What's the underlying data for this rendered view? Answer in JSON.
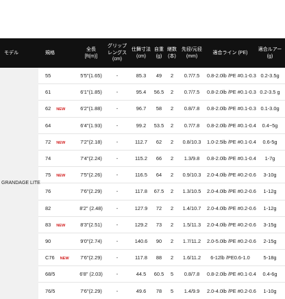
{
  "headers": {
    "model": "モデル",
    "spec": "規格",
    "length": "全長 [ft(m)]",
    "grip": "グリップ レングス (cm)",
    "closed": "仕舞寸法 (cm)",
    "weight": "自重 (g)",
    "pieces": "継数 (本)",
    "tip": "先径/元径 (mm)",
    "line": "適合ライン (PE)",
    "lure": "適合ルアー (g)"
  },
  "model_name": "GRANDAGE LITE",
  "new_label": "NEW",
  "rows": [
    {
      "spec": "55",
      "new": false,
      "length": "5'5\"(1.65)",
      "grip": "-",
      "closed": "85.3",
      "weight": "49",
      "pieces": "2",
      "tip": "0.7/7.5",
      "line": "0.8-2.0lb /PE #0.1-0.3",
      "lure": "0.2-3.5g"
    },
    {
      "spec": "61",
      "new": false,
      "length": "6'1\"(1.85)",
      "grip": "-",
      "closed": "95.4",
      "weight": "56.5",
      "pieces": "2",
      "tip": "0.7/7.5",
      "line": "0.8-2.0lb /PE #0.1-0.3",
      "lure": "0.2-3.5 g"
    },
    {
      "spec": "62",
      "new": true,
      "length": "6'2\"(1.88)",
      "grip": "-",
      "closed": "96.7",
      "weight": "58",
      "pieces": "2",
      "tip": "0.8/7.8",
      "line": "0.8-2.0lb /PE #0.1-0.3",
      "lure": "0.1-3.0g"
    },
    {
      "spec": "64",
      "new": false,
      "length": "6'4\"(1.93)",
      "grip": "-",
      "closed": "99.2",
      "weight": "53.5",
      "pieces": "2",
      "tip": "0.7/7.8",
      "line": "0.8-2.0lb /PE #0.1-0.4",
      "lure": "0.4~5g"
    },
    {
      "spec": "72",
      "new": true,
      "length": "7'2\"(2.18)",
      "grip": "-",
      "closed": "112.7",
      "weight": "62",
      "pieces": "2",
      "tip": "0.8/10.3",
      "line": "1.0-2.5lb /PE #0.1-0.4",
      "lure": "0.6-5g"
    },
    {
      "spec": "74",
      "new": false,
      "length": "7'4\"(2.24)",
      "grip": "-",
      "closed": "115.2",
      "weight": "66",
      "pieces": "2",
      "tip": "1.3/9.8",
      "line": "0.8-2.0lb /PE #0.1-0.4",
      "lure": "1-7g"
    },
    {
      "spec": "75",
      "new": true,
      "length": "7'5\"(2.26)",
      "grip": "-",
      "closed": "116.5",
      "weight": "64",
      "pieces": "2",
      "tip": "0.9/10.3",
      "line": "2.0-4.0lb /PE #0.2-0.6",
      "lure": "3-10g"
    },
    {
      "spec": "76",
      "new": false,
      "length": "7'6\"(2.29)",
      "grip": "-",
      "closed": "117.8",
      "weight": "67.5",
      "pieces": "2",
      "tip": "1.3/10.5",
      "line": "2.0-4.0lb /PE #0.2-0.6",
      "lure": "1-12g"
    },
    {
      "spec": "82",
      "new": false,
      "length": "8'2\" (2.48)",
      "grip": "-",
      "closed": "127.9",
      "weight": "72",
      "pieces": "2",
      "tip": "1.4/10.7",
      "line": "2.0-4.0lb /PE #0.2-0.6",
      "lure": "1-12g"
    },
    {
      "spec": "83",
      "new": true,
      "length": "8'3\"(2.51)",
      "grip": "-",
      "closed": "129.2",
      "weight": "73",
      "pieces": "2",
      "tip": "1.5/11.3",
      "line": "2.0-4.0lb /PE #0.2-0.6",
      "lure": "3-15g"
    },
    {
      "spec": "90",
      "new": false,
      "length": "9'0\"(2.74)",
      "grip": "-",
      "closed": "140.6",
      "weight": "90",
      "pieces": "2",
      "tip": "1.7/11.2",
      "line": "2.0-5.0lb /PE #0.2-0.6",
      "lure": "2-15g"
    },
    {
      "spec": "C76",
      "new": true,
      "length": "7'6\"(2.29)",
      "grip": "-",
      "closed": "117.8",
      "weight": "88",
      "pieces": "2",
      "tip": "1.6/11.2",
      "line": "6-12lb /PE0.6-1.0",
      "lure": "5-18g"
    },
    {
      "spec": "68/5",
      "new": false,
      "length": "6'8\" (2.03)",
      "grip": "-",
      "closed": "44.5",
      "weight": "60.5",
      "pieces": "5",
      "tip": "0.8/7.8",
      "line": "0.8-2.0lb /PE #0.1-0.4",
      "lure": "0.4-6g"
    },
    {
      "spec": "76/5",
      "new": false,
      "length": "7'6\"(2.29)",
      "grip": "-",
      "closed": "49.6",
      "weight": "78",
      "pieces": "5",
      "tip": "1.4/9.9",
      "line": "2.0-4.0lb /PE #0.2-0.6",
      "lure": "1-10g"
    }
  ]
}
